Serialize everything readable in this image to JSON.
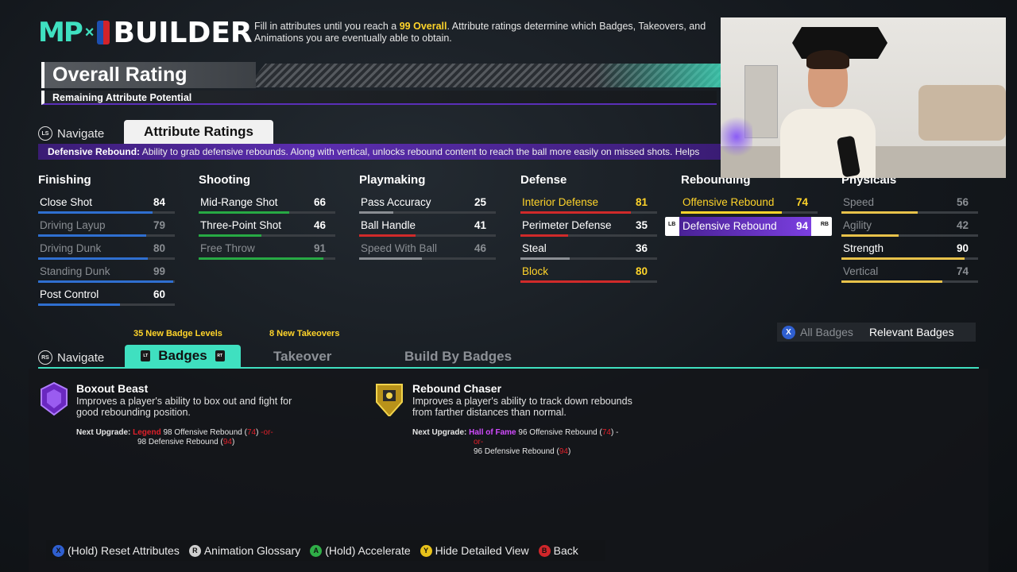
{
  "header": {
    "logo_mp": "MP",
    "logo_x": "×",
    "logo_builder": "BUILDER",
    "desc_pre": "Fill in attributes until you reach a ",
    "desc_hl": "99 Overall",
    "desc_post": ". Attribute ratings determine which Badges, Takeovers, and Animations you are eventually able to obtain.",
    "overall_title": "Overall Rating",
    "remaining": "Remaining Attribute Potential"
  },
  "tabs_top": {
    "navigate": "Navigate",
    "navigate_btn": "LS",
    "active": "Attribute Ratings"
  },
  "info_strip": {
    "label": "Defensive Rebound:",
    "text": " Ability to grab defensive rebounds. Along with vertical, unlocks rebound content to reach the ball more easily on missed shots. Helps"
  },
  "categories": [
    {
      "title": "Finishing",
      "attrs": [
        {
          "name": "Close Shot",
          "value": "84",
          "state": "normal",
          "fill": 0.84,
          "color": "#2f6fd0"
        },
        {
          "name": "Driving Layup",
          "value": "79",
          "state": "dim",
          "fill": 0.79,
          "color": "#2f6fd0"
        },
        {
          "name": "Driving Dunk",
          "value": "80",
          "state": "dim",
          "fill": 0.8,
          "color": "#2f6fd0"
        },
        {
          "name": "Standing Dunk",
          "value": "99",
          "state": "dim",
          "fill": 0.99,
          "color": "#2f6fd0"
        },
        {
          "name": "Post Control",
          "value": "60",
          "state": "normal",
          "fill": 0.6,
          "color": "#2f6fd0"
        }
      ]
    },
    {
      "title": "Shooting",
      "attrs": [
        {
          "name": "Mid-Range Shot",
          "value": "66",
          "state": "normal",
          "fill": 0.66,
          "color": "#27a944"
        },
        {
          "name": "Three-Point Shot",
          "value": "46",
          "state": "normal",
          "fill": 0.46,
          "color": "#27a944"
        },
        {
          "name": "Free Throw",
          "value": "91",
          "state": "dim",
          "fill": 0.91,
          "color": "#27a944"
        }
      ]
    },
    {
      "title": "Playmaking",
      "attrs": [
        {
          "name": "Pass Accuracy",
          "value": "25",
          "state": "normal",
          "fill": 0.25,
          "color": "#8a8e93"
        },
        {
          "name": "Ball Handle",
          "value": "41",
          "state": "normal",
          "fill": 0.41,
          "color": "#d02a2a"
        },
        {
          "name": "Speed With Ball",
          "value": "46",
          "state": "dim",
          "fill": 0.46,
          "color": "#8a8e93"
        }
      ]
    },
    {
      "title": "Defense",
      "attrs": [
        {
          "name": "Interior Defense",
          "value": "81",
          "state": "gold",
          "fill": 0.81,
          "color": "#d02a2a"
        },
        {
          "name": "Perimeter Defense",
          "value": "35",
          "state": "normal",
          "fill": 0.35,
          "color": "#d02a2a"
        },
        {
          "name": "Steal",
          "value": "36",
          "state": "normal",
          "fill": 0.36,
          "color": "#8a8e93"
        },
        {
          "name": "Block",
          "value": "80",
          "state": "gold",
          "fill": 0.8,
          "color": "#d02a2a"
        }
      ]
    },
    {
      "title": "Rebounding",
      "attrs": [
        {
          "name": "Offensive Rebound",
          "value": "74",
          "state": "gold",
          "fill": 0.74,
          "color": "#ffd42a"
        },
        {
          "name": "Defensive Rebound",
          "value": "94",
          "state": "sel",
          "fill": 0.94,
          "color": "#ffd42a"
        }
      ]
    },
    {
      "title": "Physicals",
      "attrs": [
        {
          "name": "Speed",
          "value": "56",
          "state": "dim",
          "fill": 0.56,
          "color": "#e8c24a"
        },
        {
          "name": "Agility",
          "value": "42",
          "state": "dim",
          "fill": 0.42,
          "color": "#e8c24a"
        },
        {
          "name": "Strength",
          "value": "90",
          "state": "normal",
          "fill": 0.9,
          "color": "#e8c24a"
        },
        {
          "name": "Vertical",
          "value": "74",
          "state": "dim",
          "fill": 0.74,
          "color": "#e8c24a"
        }
      ]
    }
  ],
  "sel_buttons": {
    "left": "LB",
    "right": "RB"
  },
  "badges_section": {
    "new_badge_levels": "35 New Badge Levels",
    "new_takeovers": "8 New Takeovers",
    "navigate": "Navigate",
    "navigate_btn": "RS",
    "tab_badges": "Badges",
    "tab_badges_lt": "LT",
    "tab_badges_rt": "RT",
    "tab_takeover": "Takeover",
    "tab_build": "Build By Badges",
    "all_badges_btn": "X",
    "all_badges": "All Badges",
    "relevant_badges": "Relevant Badges"
  },
  "badges": [
    {
      "title": "Boxout Beast",
      "desc": "Improves a player's ability to box out and fight for good rebounding position.",
      "next_label": "Next Upgrade:",
      "tier": "Legend",
      "req1": "98 Offensive Rebound (",
      "req1_val": "74",
      "req1_close": ")",
      "or": " -or-",
      "req2": "98 Defensive Rebound (",
      "req2_val": "94",
      "req2_close": ")",
      "icon": "purple-badge-icon",
      "color": "#7a2fd0"
    },
    {
      "title": "Rebound Chaser",
      "desc": "Improves a player's ability to track down rebounds from farther distances than normal.",
      "next_label": "Next Upgrade:",
      "tier": "Hall of Fame",
      "req1": "96 Offensive Rebound (",
      "req1_val": "74",
      "req1_close": ") -",
      "or": "or-",
      "req2": "96 Defensive Rebound (",
      "req2_val": "94",
      "req2_close": ")",
      "icon": "gold-badge-icon",
      "color": "#d6b326"
    }
  ],
  "footer": [
    {
      "btn": "X",
      "label": "(Hold) Reset Attributes",
      "color": "#2f5fd0",
      "icon": "x-button-icon"
    },
    {
      "btn": "R",
      "label": "Animation Glossary",
      "color": "#cfcfcf",
      "icon": "r-stick-icon"
    },
    {
      "btn": "A",
      "label": "(Hold) Accelerate",
      "color": "#2fae47",
      "icon": "a-button-icon"
    },
    {
      "btn": "Y",
      "label": "Hide Detailed View",
      "color": "#e8c21a",
      "icon": "y-button-icon"
    },
    {
      "btn": "B",
      "label": "Back",
      "color": "#d0262a",
      "icon": "b-button-icon"
    }
  ]
}
